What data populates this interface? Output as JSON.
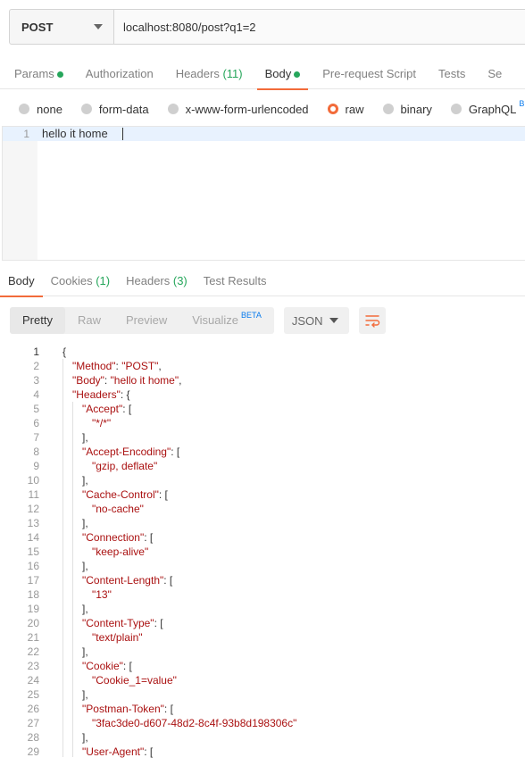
{
  "request": {
    "method": "POST",
    "url": "localhost:8080/post?q1=2"
  },
  "request_tabs": [
    {
      "label": "Params",
      "dot": true
    },
    {
      "label": "Authorization"
    },
    {
      "label": "Headers",
      "count": "(11)"
    },
    {
      "label": "Body",
      "dot": true,
      "active": true
    },
    {
      "label": "Pre-request Script"
    },
    {
      "label": "Tests"
    },
    {
      "label": "Se"
    }
  ],
  "body_types": [
    {
      "label": "none"
    },
    {
      "label": "form-data"
    },
    {
      "label": "x-www-form-urlencoded"
    },
    {
      "label": "raw",
      "checked": true
    },
    {
      "label": "binary"
    },
    {
      "label": "GraphQL",
      "beta": "BETA"
    }
  ],
  "editor": {
    "line_number": "1",
    "text": "hello it home"
  },
  "response_tabs": [
    {
      "label": "Body",
      "active": true
    },
    {
      "label": "Cookies",
      "count": "(1)"
    },
    {
      "label": "Headers",
      "count": "(3)"
    },
    {
      "label": "Test Results"
    }
  ],
  "view_modes": [
    {
      "label": "Pretty",
      "active": true
    },
    {
      "label": "Raw"
    },
    {
      "label": "Preview"
    },
    {
      "label": "Visualize",
      "beta": "BETA"
    }
  ],
  "format": "JSON",
  "icons": {
    "method_dropdown": "chevron-down-icon",
    "format_dropdown": "chevron-down-icon",
    "wrap": "wrap-lines-icon"
  },
  "colors": {
    "accent": "#f26b3a",
    "green": "#26a65b",
    "beta": "#097bed",
    "json_string": "#aa1111"
  },
  "response_lines": [
    {
      "n": "1",
      "indent": 0,
      "parts": [
        {
          "t": "{"
        }
      ]
    },
    {
      "n": "2",
      "indent": 1,
      "parts": [
        {
          "t": "\"Method\"",
          "c": "k"
        },
        {
          "t": ": "
        },
        {
          "t": "\"POST\"",
          "c": "s"
        },
        {
          "t": ","
        }
      ]
    },
    {
      "n": "3",
      "indent": 1,
      "parts": [
        {
          "t": "\"Body\"",
          "c": "k"
        },
        {
          "t": ": "
        },
        {
          "t": "\"hello it home\"",
          "c": "s"
        },
        {
          "t": ","
        }
      ]
    },
    {
      "n": "4",
      "indent": 1,
      "parts": [
        {
          "t": "\"Headers\"",
          "c": "k"
        },
        {
          "t": ": {"
        }
      ]
    },
    {
      "n": "5",
      "indent": 2,
      "parts": [
        {
          "t": "\"Accept\"",
          "c": "k"
        },
        {
          "t": ": ["
        }
      ]
    },
    {
      "n": "6",
      "indent": 3,
      "parts": [
        {
          "t": "\"*/*\"",
          "c": "s"
        }
      ]
    },
    {
      "n": "7",
      "indent": 2,
      "parts": [
        {
          "t": "],"
        }
      ]
    },
    {
      "n": "8",
      "indent": 2,
      "parts": [
        {
          "t": "\"Accept-Encoding\"",
          "c": "k"
        },
        {
          "t": ": ["
        }
      ]
    },
    {
      "n": "9",
      "indent": 3,
      "parts": [
        {
          "t": "\"gzip, deflate\"",
          "c": "s"
        }
      ]
    },
    {
      "n": "10",
      "indent": 2,
      "parts": [
        {
          "t": "],"
        }
      ]
    },
    {
      "n": "11",
      "indent": 2,
      "parts": [
        {
          "t": "\"Cache-Control\"",
          "c": "k"
        },
        {
          "t": ": ["
        }
      ]
    },
    {
      "n": "12",
      "indent": 3,
      "parts": [
        {
          "t": "\"no-cache\"",
          "c": "s"
        }
      ]
    },
    {
      "n": "13",
      "indent": 2,
      "parts": [
        {
          "t": "],"
        }
      ]
    },
    {
      "n": "14",
      "indent": 2,
      "parts": [
        {
          "t": "\"Connection\"",
          "c": "k"
        },
        {
          "t": ": ["
        }
      ]
    },
    {
      "n": "15",
      "indent": 3,
      "parts": [
        {
          "t": "\"keep-alive\"",
          "c": "s"
        }
      ]
    },
    {
      "n": "16",
      "indent": 2,
      "parts": [
        {
          "t": "],"
        }
      ]
    },
    {
      "n": "17",
      "indent": 2,
      "parts": [
        {
          "t": "\"Content-Length\"",
          "c": "k"
        },
        {
          "t": ": ["
        }
      ]
    },
    {
      "n": "18",
      "indent": 3,
      "parts": [
        {
          "t": "\"13\"",
          "c": "s"
        }
      ]
    },
    {
      "n": "19",
      "indent": 2,
      "parts": [
        {
          "t": "],"
        }
      ]
    },
    {
      "n": "20",
      "indent": 2,
      "parts": [
        {
          "t": "\"Content-Type\"",
          "c": "k"
        },
        {
          "t": ": ["
        }
      ]
    },
    {
      "n": "21",
      "indent": 3,
      "parts": [
        {
          "t": "\"text/plain\"",
          "c": "s"
        }
      ]
    },
    {
      "n": "22",
      "indent": 2,
      "parts": [
        {
          "t": "],"
        }
      ]
    },
    {
      "n": "23",
      "indent": 2,
      "parts": [
        {
          "t": "\"Cookie\"",
          "c": "k"
        },
        {
          "t": ": ["
        }
      ]
    },
    {
      "n": "24",
      "indent": 3,
      "parts": [
        {
          "t": "\"Cookie_1=value\"",
          "c": "s"
        }
      ]
    },
    {
      "n": "25",
      "indent": 2,
      "parts": [
        {
          "t": "],"
        }
      ]
    },
    {
      "n": "26",
      "indent": 2,
      "parts": [
        {
          "t": "\"Postman-Token\"",
          "c": "k"
        },
        {
          "t": ": ["
        }
      ]
    },
    {
      "n": "27",
      "indent": 3,
      "parts": [
        {
          "t": "\"3fac3de0-d607-48d2-8c4f-93b8d198306c\"",
          "c": "s"
        }
      ]
    },
    {
      "n": "28",
      "indent": 2,
      "parts": [
        {
          "t": "],"
        }
      ]
    },
    {
      "n": "29",
      "indent": 2,
      "parts": [
        {
          "t": "\"User-Agent\"",
          "c": "k"
        },
        {
          "t": ": ["
        }
      ]
    }
  ]
}
